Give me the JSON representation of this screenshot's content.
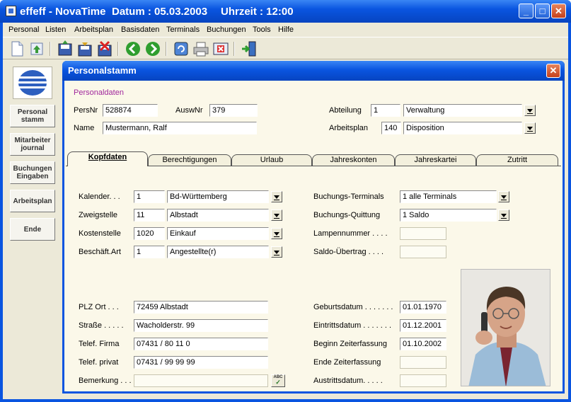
{
  "titlebar": {
    "app_name": "effeff - NovaTime",
    "date": "Datum : 05.03.2003",
    "time": "Uhrzeit : 12:00"
  },
  "menu": [
    "Personal",
    "Listen",
    "Arbeitsplan",
    "Basisdaten",
    "Terminals",
    "Buchungen",
    "Tools",
    "Hilfe"
  ],
  "toolbar_icons": [
    "new-document-icon",
    "upload-icon",
    "save-icon",
    "save-all-icon",
    "delete-icon",
    "back-icon",
    "forward-icon",
    "refresh-icon",
    "print-icon",
    "close-record-icon",
    "exit-icon"
  ],
  "sidebar": {
    "buttons": [
      {
        "line1": "Personal",
        "line2": "stamm"
      },
      {
        "line1": "Mitarbeiter",
        "line2": "journal"
      },
      {
        "line1": "Buchungen",
        "line2": "Eingaben"
      },
      {
        "line1": "Arbeitsplan",
        "line2": ""
      },
      {
        "line1": "Ende",
        "line2": ""
      }
    ]
  },
  "dialog": {
    "title": "Personalstamm",
    "section_label": "Personaldaten",
    "persnr_label": "PersNr",
    "persnr": "528874",
    "auswnr_label": "AuswNr",
    "auswnr": "379",
    "name_label": "Name",
    "name": "Mustermann, Ralf",
    "abteilung_label": "Abteilung",
    "abteilung_nr": "1",
    "abteilung": "Verwaltung",
    "arbeitsplan_label": "Arbeitsplan",
    "arbeitsplan_nr": "140",
    "arbeitsplan": "Disposition"
  },
  "tabs": [
    "Kopfdaten",
    "Berechtigungen",
    "Urlaub",
    "Jahreskonten",
    "Jahreskartei",
    "Zutritt"
  ],
  "kopf": {
    "kalender_label": "Kalender. . .",
    "kalender_nr": "1",
    "kalender": "Bd-Württemberg",
    "zweig_label": "Zweigstelle",
    "zweig_nr": "11",
    "zweig": "Albstadt",
    "kosten_label": "Kostenstelle",
    "kosten_nr": "1020",
    "kosten": "Einkauf",
    "beschaeft_label": "Beschäft.Art",
    "beschaeft_nr": "1",
    "beschaeft": "Angestellte(r)",
    "buchterm_label": "Buchungs-Terminals",
    "buchterm": "1  alle Terminals",
    "buchquit_label": "Buchungs-Quittung",
    "buchquit": "1  Saldo",
    "lampen_label": "Lampennummer . . . .",
    "lampen": "",
    "saldo_label": "Saldo-Übertrag . . . .",
    "saldo": "",
    "plz_label": "PLZ Ort . . .",
    "plz": "72459 Albstadt",
    "strasse_label": "Straße . . . . .",
    "strasse": "Wacholderstr. 99",
    "telfirma_label": "Telef. Firma",
    "telfirma": "07431 / 80 11 0",
    "telprivat_label": "Telef. privat",
    "telprivat": "07431 / 99 99 99",
    "bemerkung_label": "Bemerkung . . .",
    "bemerkung": "",
    "spell_label": "ABC",
    "geburt_label": "Geburtsdatum . . . . . . .",
    "geburt": "01.01.1970",
    "eintritt_label": "Eintrittsdatum . . . . . . .",
    "eintritt": "01.12.2001",
    "beginn_label": "Beginn Zeiterfassung",
    "beginn": "01.10.2002",
    "ende_label": "Ende  Zeiterfassung",
    "ende": "",
    "austritt_label": "Austrittsdatum. . . . .",
    "austritt": ""
  }
}
